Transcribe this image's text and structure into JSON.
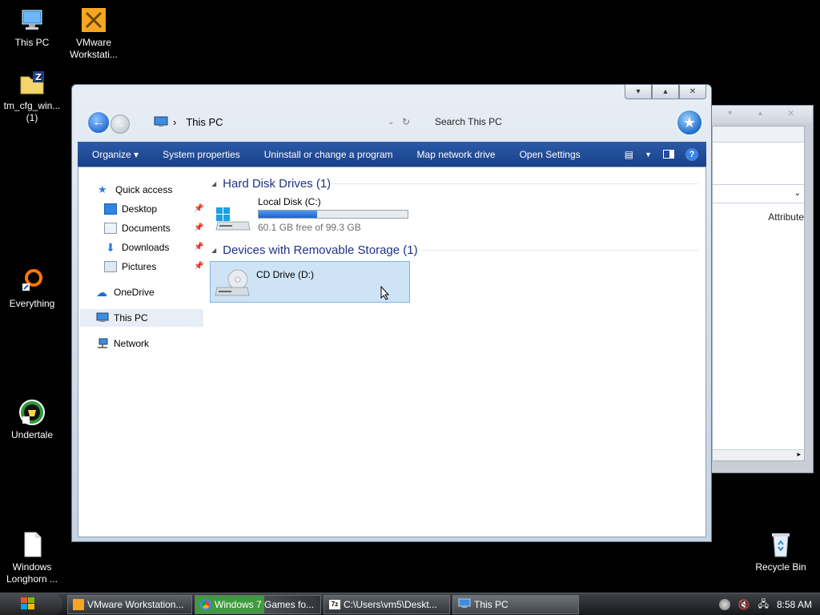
{
  "desktop": {
    "icons": [
      {
        "label": "This PC"
      },
      {
        "label": "VMware Workstati..."
      },
      {
        "label": "tm_cfg_win... (1)"
      },
      {
        "label": "Everything"
      },
      {
        "label": "Undertale"
      },
      {
        "label": "Windows Longhorn ..."
      },
      {
        "label": "Recycle Bin"
      }
    ]
  },
  "window": {
    "address": "This PC",
    "search_placeholder": "Search This PC",
    "controls": {
      "minimize": "▾",
      "maximize": "▴",
      "close": "✕"
    },
    "toolbar": {
      "organize": "Organize ▾",
      "system_properties": "System properties",
      "uninstall": "Uninstall or change a program",
      "map_drive": "Map network drive",
      "open_settings": "Open Settings",
      "help": "?"
    },
    "nav": {
      "quick_access": "Quick access",
      "desktop": "Desktop",
      "documents": "Documents",
      "downloads": "Downloads",
      "pictures": "Pictures",
      "onedrive": "OneDrive",
      "this_pc": "This PC",
      "network": "Network"
    },
    "groups": {
      "hdd": "Hard Disk Drives (1)",
      "removable": "Devices with Removable Storage (1)"
    },
    "drives": {
      "c": {
        "name": "Local Disk (C:)",
        "free_text": "60.1 GB free of 99.3 GB",
        "used_fraction": 0.395
      },
      "d": {
        "name": "CD Drive (D:)"
      }
    }
  },
  "bg_window": {
    "column_header": "Attribute"
  },
  "taskbar": {
    "items": [
      {
        "label": "VMware Workstation..."
      },
      {
        "label": "Windows 7 Games fo..."
      },
      {
        "label": "C:\\Users\\vm5\\Deskt..."
      },
      {
        "label": "This PC"
      }
    ],
    "clock": "8:58 AM"
  },
  "colors": {
    "accent": "#1a4088",
    "group_heading": "#1e3287",
    "selection": "#cfe3f7"
  }
}
